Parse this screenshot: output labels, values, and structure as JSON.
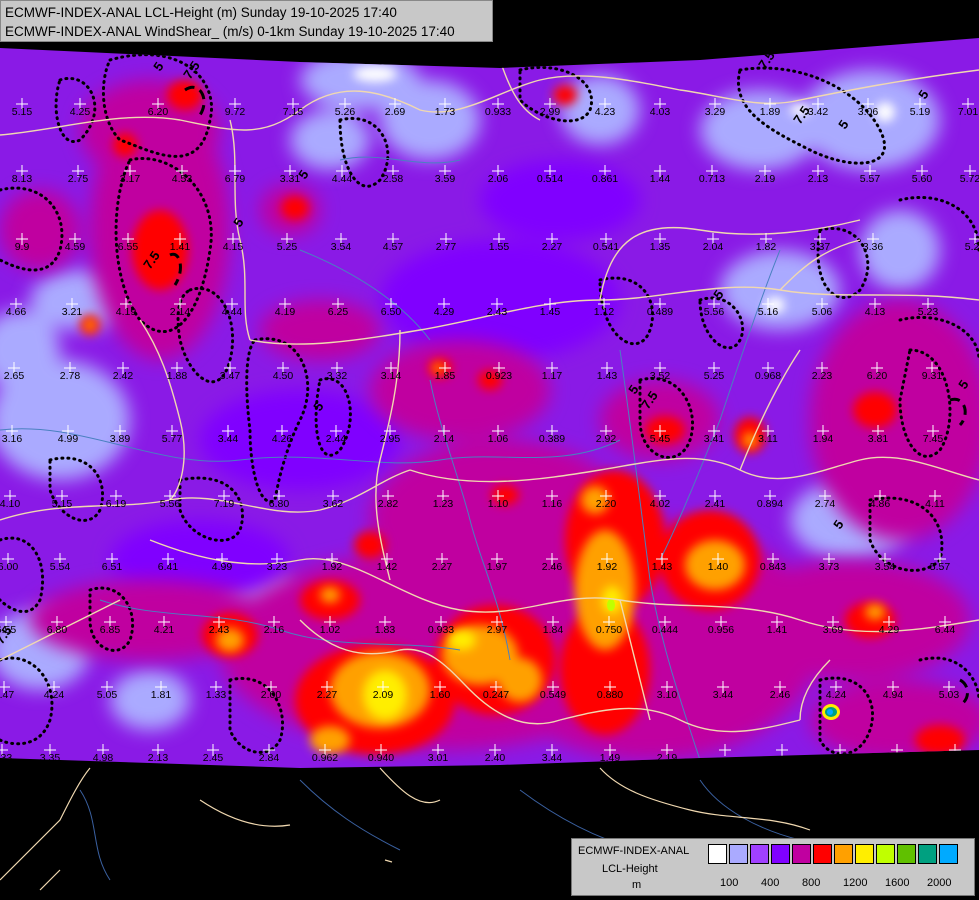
{
  "header": {
    "line1": "ECMWF-INDEX-ANAL LCL-Height (m) Sunday 19-10-2025 17:40",
    "line2": "ECMWF-INDEX-ANAL WindShear_ (m/s) 0-1km Sunday 19-10-2025 17:40"
  },
  "legend": {
    "model": "ECMWF-INDEX-ANAL",
    "variable": "LCL-Height",
    "unit": "m",
    "colors": [
      "#ffffff",
      "#aaaaff",
      "#a040ff",
      "#8000ff",
      "#c000a0",
      "#ff0000",
      "#ffa000",
      "#ffee00",
      "#c0ff00",
      "#60c000",
      "#00a080",
      "#00aaff"
    ],
    "ticks": [
      "100",
      "400",
      "800",
      "1200",
      "1600",
      "2000"
    ]
  },
  "colors": {
    "background": "#000000",
    "field_base": "#8a1ae6",
    "border": "#f0d8b0",
    "river": "#4a80c0"
  },
  "station_values": [
    "5.15",
    "4.25",
    "6.20",
    "9.72",
    "7.15",
    "5.26",
    "2.69",
    "1.73",
    "0.933",
    "2.99",
    "4.23",
    "4.03",
    "3.29",
    "1.89",
    "3.42",
    "3.06",
    "5.19",
    "7.01",
    "8.13",
    "2.75",
    "3.17",
    "4.53",
    "6.79",
    "3.31",
    "4.44",
    "2.58",
    "3.59",
    "2.06",
    "0.514",
    "0.861",
    "1.44",
    "0.713",
    "2.19",
    "2.13",
    "5.57",
    "5.60",
    "5.72",
    "9.9",
    "4.59",
    "6.55",
    "1.41",
    "4.15",
    "5.25",
    "3.54",
    "4.57",
    "2.77",
    "1.55",
    "2.27",
    "0.541",
    "1.35",
    "2.04",
    "1.82",
    "3.37",
    "3.36",
    "5.26",
    "4.66",
    "3.21",
    "4.19",
    "2.14",
    "4.44",
    "4.19",
    "6.25",
    "6.50",
    "4.29",
    "2.43",
    "1.45",
    "1.12",
    "0.489",
    "5.56",
    "5.16",
    "5.06",
    "4.13",
    "5.23",
    "2.65",
    "2.78",
    "2.42",
    "1.88",
    "3.47",
    "4.50",
    "3.32",
    "3.14",
    "1.85",
    "0.923",
    "1.17",
    "1.43",
    "3.52",
    "5.25",
    "0.968",
    "2.23",
    "6.20",
    "9.31",
    "3.16",
    "4.99",
    "3.89",
    "5.77",
    "3.44",
    "4.26",
    "2.44",
    "2.95",
    "2.14",
    "1.06",
    "0.389",
    "2.92",
    "5.45",
    "3.41",
    "3.11",
    "1.94",
    "3.81",
    "7.45",
    "4.10",
    "5.15",
    "6.19",
    "5.56",
    "7.19",
    "6.80",
    "3.62",
    "2.82",
    "1.23",
    "1.10",
    "1.16",
    "2.20",
    "4.02",
    "2.41",
    "0.894",
    "2.74",
    "4.86",
    "4.11",
    "6.00",
    "5.54",
    "6.51",
    "6.41",
    "4.99",
    "3.23",
    "1.92",
    "1.42",
    "2.27",
    "1.97",
    "2.46",
    "1.92",
    "1.43",
    "1.40",
    "0.843",
    "3.73",
    "3.54",
    "5.57",
    "6.55",
    "6.80",
    "6.85",
    "4.21",
    "2.43",
    "2.16",
    "1.02",
    "1.83",
    "0.933",
    "2.97",
    "1.84",
    "0.750",
    "0.444",
    "0.956",
    "1.41",
    "3.69",
    "4.29",
    "6.44",
    "5.47",
    "4.24",
    "5.05",
    "1.81",
    "1.33",
    "2.00",
    "2.27",
    "2.09",
    "1.60",
    "0.247",
    "0.549",
    "0.880",
    "3.10",
    "3.44",
    "2.46",
    "4.24",
    "4.94",
    "5.03",
    "3.33",
    "3.35",
    "4.98",
    "2.13",
    "2.45",
    "2.84",
    "0.962",
    "0.940",
    "3.01",
    "2.40",
    "3.44",
    "1.49",
    "2.19"
  ],
  "contour_labels": [
    "5",
    "7.5",
    "5",
    "7.5",
    "5",
    "5",
    "7.5",
    "5",
    "5",
    "7.5",
    "5",
    "5",
    "7.5",
    "5",
    "5",
    "7.5"
  ]
}
